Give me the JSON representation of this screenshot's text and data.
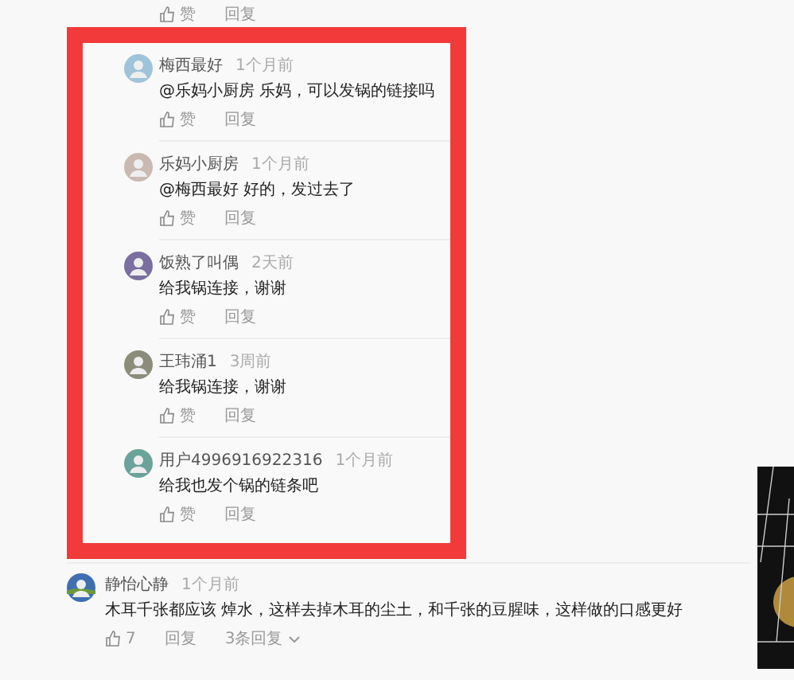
{
  "top_actions": {
    "like": "赞",
    "reply": "回复"
  },
  "replies": [
    {
      "name": "梅西最好",
      "time": "1个月前",
      "text": "@乐妈小厨房 乐妈，可以发锅的链接吗",
      "like": "赞",
      "reply": "回复"
    },
    {
      "name": "乐妈小厨房",
      "time": "1个月前",
      "text": "@梅西最好 好的，发过去了",
      "like": "赞",
      "reply": "回复"
    },
    {
      "name": "饭熟了叫偶",
      "time": "2天前",
      "text": "给我锅连接，谢谢",
      "like": "赞",
      "reply": "回复"
    },
    {
      "name": "王玮涌1",
      "time": "3周前",
      "text": "给我锅连接，谢谢",
      "like": "赞",
      "reply": "回复"
    },
    {
      "name": "用户4996916922316",
      "time": "1个月前",
      "text": "给我也发个锅的链条吧",
      "like": "赞",
      "reply": "回复"
    }
  ],
  "comment": {
    "name": "静怡心静",
    "time": "1个月前",
    "text": "木耳千张都应该 焯水，这样去掉木耳的尘土，和千张的豆腥味，这样做的口感更好",
    "likes": "7",
    "reply": "回复",
    "replies_link": "3条回复"
  }
}
